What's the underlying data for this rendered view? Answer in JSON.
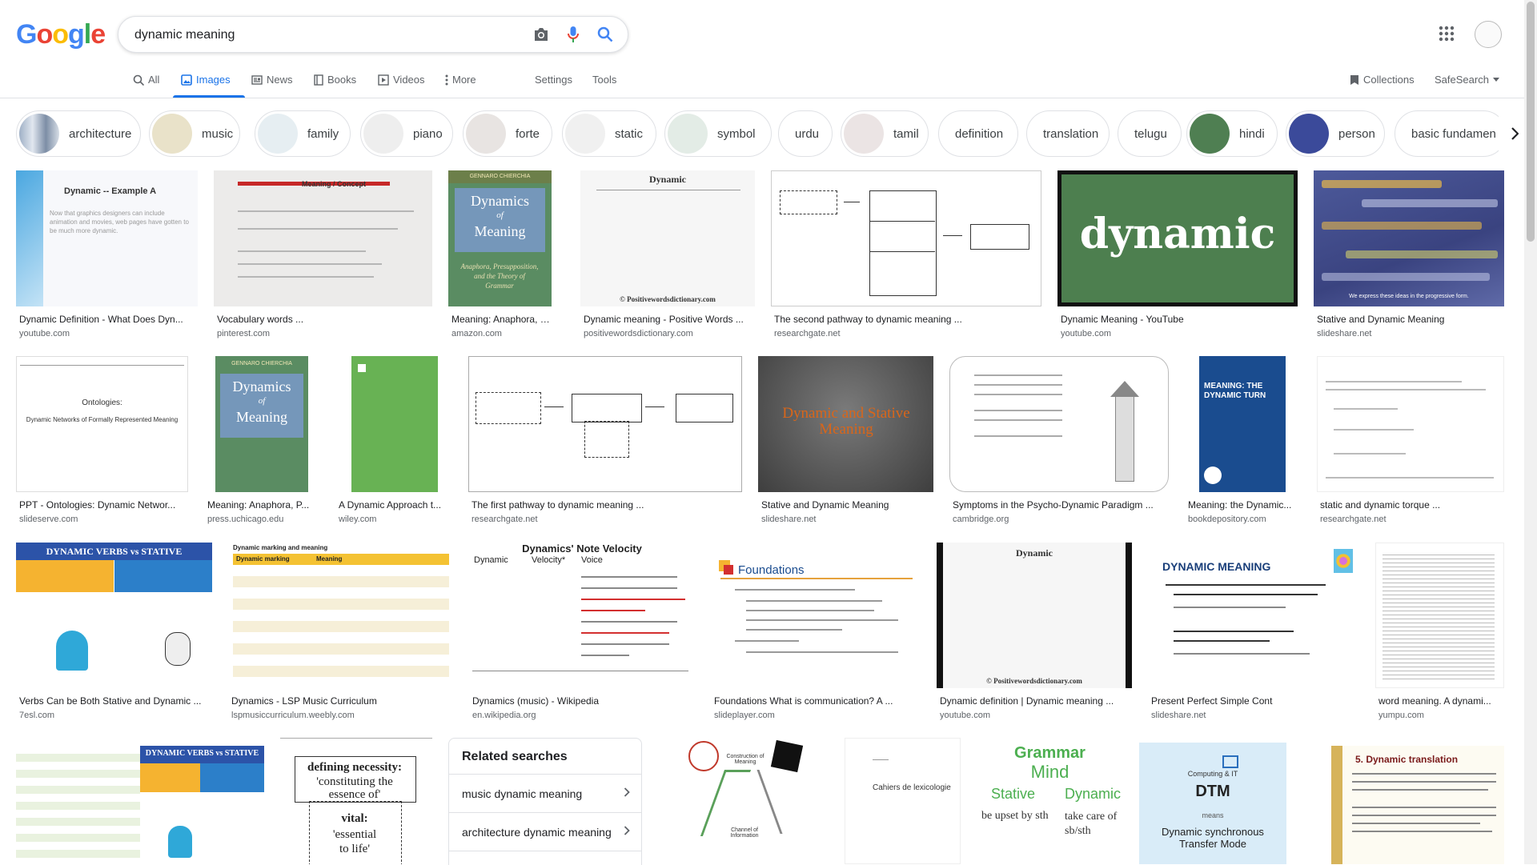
{
  "logo": {
    "text": "Google"
  },
  "search": {
    "query": "dynamic meaning"
  },
  "tabs": [
    {
      "label": "All",
      "icon": "search-icon"
    },
    {
      "label": "Images",
      "icon": "image-icon",
      "active": true
    },
    {
      "label": "News",
      "icon": "news-icon"
    },
    {
      "label": "Books",
      "icon": "book-icon"
    },
    {
      "label": "Videos",
      "icon": "video-icon"
    },
    {
      "label": "More",
      "icon": "more-vert-icon"
    }
  ],
  "tools": {
    "settings": "Settings",
    "tools": "Tools",
    "collections": "Collections",
    "safesearch": "SafeSearch"
  },
  "chips": [
    {
      "label": "architecture"
    },
    {
      "label": "music"
    },
    {
      "label": "family"
    },
    {
      "label": "piano"
    },
    {
      "label": "forte"
    },
    {
      "label": "static"
    },
    {
      "label": "symbol"
    },
    {
      "label": "urdu"
    },
    {
      "label": "tamil"
    },
    {
      "label": "definition"
    },
    {
      "label": "translation"
    },
    {
      "label": "telugu"
    },
    {
      "label": "hindi"
    },
    {
      "label": "person"
    },
    {
      "label": "basic fundamen"
    }
  ],
  "row1": [
    {
      "caption": "Dynamic Definition - What Does Dyn...",
      "domain": "youtube.com",
      "img": {
        "title": "Dynamic -- Example A",
        "body": "Now that graphics designers can include animation and movies, web pages have gotten to be much more dynamic."
      }
    },
    {
      "caption": "Vocabulary words ...",
      "domain": "pinterest.com",
      "img": {
        "title": "Meaning / Concept"
      }
    },
    {
      "caption": "Meaning: Anaphora, P...",
      "domain": "amazon.com",
      "img": {
        "author": "GENNARO CHIERCHIA",
        "title1": "Dynamics",
        "title2": "of",
        "title3": "Meaning",
        "sub": "Anaphora, Presupposition, and the Theory of Grammar"
      }
    },
    {
      "caption": "Dynamic meaning - Positive Words ...",
      "domain": "positivewordsdictionary.com",
      "img": {
        "title": "Dynamic",
        "footer": "© Positivewordsdictionary.com"
      }
    },
    {
      "caption": "The second pathway to dynamic meaning ...",
      "domain": "researchgate.net",
      "img": {}
    },
    {
      "caption": "Dynamic Meaning - YouTube",
      "domain": "youtube.com",
      "img": {
        "word": "dynamic"
      }
    },
    {
      "caption": "Stative and Dynamic Meaning",
      "domain": "slideshare.net",
      "img": {
        "footer": "We express these ideas in the progressive form."
      }
    }
  ],
  "row2": [
    {
      "caption": "PPT - Ontologies: Dynamic Networ...",
      "domain": "slideserve.com",
      "img": {
        "title": "Ontologies:",
        "sub": "Dynamic Networks of Formally Represented Meaning"
      }
    },
    {
      "caption": "Meaning: Anaphora, P...",
      "domain": "press.uchicago.edu",
      "img": {
        "author": "GENNARO CHIERCHIA",
        "title1": "Dynamics",
        "title2": "of",
        "title3": "Meaning"
      }
    },
    {
      "caption": "A Dynamic Approach t...",
      "domain": "wiley.com",
      "img": {}
    },
    {
      "caption": "The first pathway to dynamic meaning ...",
      "domain": "researchgate.net",
      "img": {}
    },
    {
      "caption": "Stative and Dynamic Meaning",
      "domain": "slideshare.net",
      "img": {
        "word": "Dynamic and Stative Meaning"
      }
    },
    {
      "caption": "Symptoms in the Psycho-Dynamic Paradigm ...",
      "domain": "cambridge.org",
      "img": {}
    },
    {
      "caption": "Meaning: the Dynamic...",
      "domain": "bookdepository.com",
      "img": {
        "title": "MEANING: THE DYNAMIC TURN"
      }
    },
    {
      "caption": "static and dynamic torque ...",
      "domain": "researchgate.net",
      "img": {}
    }
  ],
  "row3": [
    {
      "caption": "Verbs Can be Both Stative and Dynamic ...",
      "domain": "7esl.com",
      "img": {
        "title": "DYNAMIC VERBS vs STATIVE"
      }
    },
    {
      "caption": "Dynamics - LSP Music Curriculum",
      "domain": "lspmusiccurriculum.weebly.com",
      "img": {
        "title": "Dynamic marking and meaning",
        "h1": "Dynamic marking",
        "h2": "Meaning"
      }
    },
    {
      "caption": "Dynamics (music) - Wikipedia",
      "domain": "en.wikipedia.org",
      "img": {
        "title": "Dynamics' Note Velocity",
        "h1": "Dynamic",
        "h2": "Velocity*",
        "h3": "Voice"
      }
    },
    {
      "caption": "Foundations What is communication? A ...",
      "domain": "slideplayer.com",
      "img": {
        "title": "Foundations"
      }
    },
    {
      "caption": "Dynamic definition | Dynamic meaning ...",
      "domain": "youtube.com",
      "img": {
        "title": "Dynamic",
        "footer": "© Positivewordsdictionary.com"
      }
    },
    {
      "caption": "Present Perfect Simple Cont",
      "domain": "slideshare.net",
      "img": {
        "title": "DYNAMIC MEANING"
      }
    },
    {
      "caption": "word meaning. A dynami...",
      "domain": "yumpu.com",
      "img": {}
    }
  ],
  "row4": [
    {
      "img": {
        "title": "DYNAMIC VERBS vs STATIVE"
      }
    },
    {
      "img": {
        "l1": "defining necessity:",
        "l2": "'constituting the",
        "l3": "essence of'",
        "l4": "vital:",
        "l5": "'essential",
        "l6": "to life'"
      }
    },
    {
      "img": {
        "l1": "Construction of Meaning",
        "l2": "Channel of Information"
      }
    },
    {
      "img": {
        "l1": "Cahiers de lexicologie"
      }
    },
    {
      "img": {
        "l1": "Grammar",
        "l2": "Mind",
        "l3": "Stative",
        "l4": "Dynamic",
        "l5": "be upset by sth",
        "l6": "take care of sb/sth"
      }
    },
    {
      "img": {
        "l1": "Computing & IT",
        "l2": "DTM",
        "l3": "means",
        "l4": "Dynamic synchronous Transfer Mode"
      }
    },
    {
      "img": {
        "l1": "5. Dynamic translation"
      }
    }
  ],
  "related": {
    "title": "Related searches",
    "items": [
      "music dynamic meaning",
      "architecture dynamic meaning"
    ]
  },
  "colors": {
    "accent": "#1a73e8",
    "text": "#202124",
    "muted": "#5f6368",
    "border": "#dfe1e5"
  }
}
